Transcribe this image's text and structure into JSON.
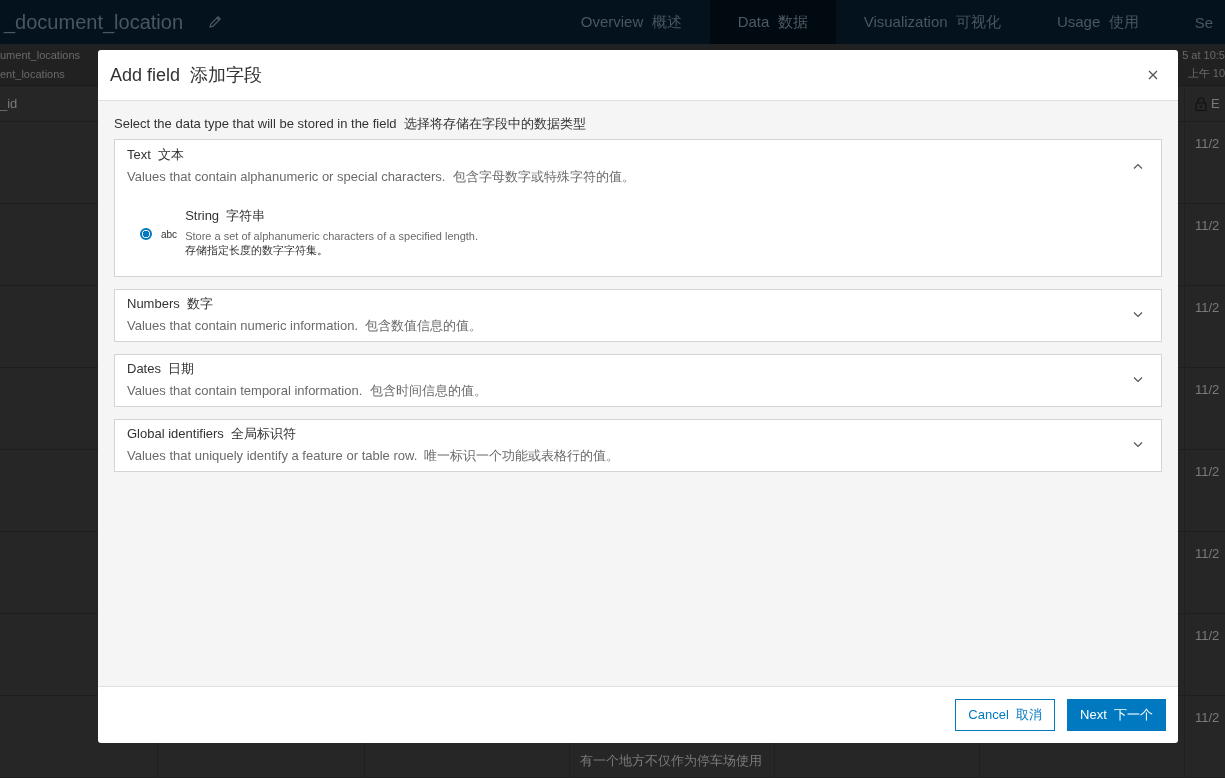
{
  "header": {
    "title": "_document_location",
    "tabs": [
      {
        "label": "Overview  概述",
        "selected": false
      },
      {
        "label": "Data  数据",
        "selected": true
      },
      {
        "label": "Visualization  可视化",
        "selected": false
      },
      {
        "label": "Usage  使用",
        "selected": false
      },
      {
        "label": "Se",
        "selected": false
      }
    ]
  },
  "info": {
    "left": [
      "ument_locations",
      "ent_locations"
    ],
    "right": [
      "5 at 10:5",
      "上午 10"
    ]
  },
  "table": {
    "first_header": "_id",
    "last_header": "E",
    "last_column": [
      "11/2",
      "11/2",
      "11/2",
      "11/2",
      "11/2",
      "11/2",
      "11/2",
      "11/2"
    ],
    "bottom_text": "有一个地方不仅作为停车场使用"
  },
  "dialog": {
    "title": "Add field  添加字段",
    "prompt": "Select the data type that will be stored in the field  选择将存储在字段中的数据类型",
    "sections": [
      {
        "title": "Text  文本",
        "description": "Values that contain alphanumeric or special characters.  包含字母数字或特殊字符的值。",
        "expanded": true,
        "options": [
          {
            "label": "String  字符串",
            "type_text": "abc",
            "description": [
              "Store a set of alphanumeric characters of a specified length.",
              "存储指定长度的数字字符集。"
            ],
            "selected": true
          }
        ]
      },
      {
        "title": "Numbers  数字",
        "description": "Values that contain numeric information.  包含数值信息的值。",
        "expanded": false
      },
      {
        "title": "Dates  日期",
        "description": "Values that contain temporal information.  包含时间信息的值。",
        "expanded": false
      },
      {
        "title": "Global identifiers  全局标识符",
        "description": "Values that uniquely identify a feature or table row.  唯一标识一个功能或表格行的值。",
        "expanded": false
      }
    ],
    "buttons": [
      {
        "label": "Cancel  取消",
        "kind": "secondary"
      },
      {
        "label": "Next  下一个",
        "kind": "primary"
      }
    ]
  }
}
